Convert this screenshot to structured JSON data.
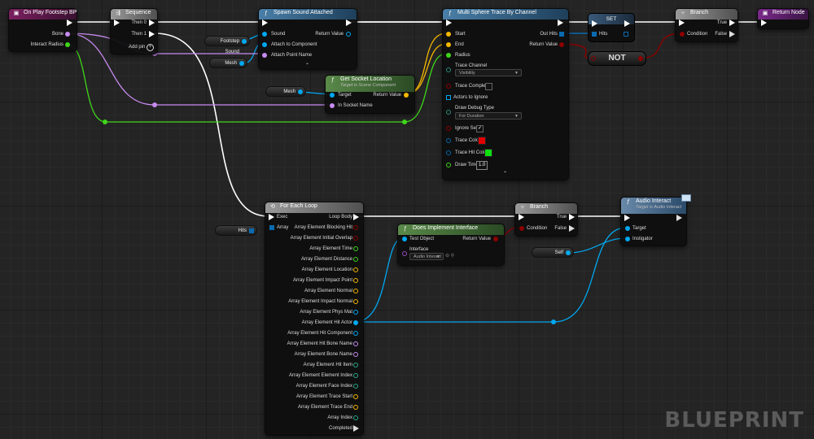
{
  "watermark": "BLUEPRINT",
  "event_node": {
    "title": "On Play Footstep BP",
    "pins": [
      "Bone",
      "Interact Radius"
    ]
  },
  "sequence_node": {
    "title": "Sequence",
    "then0": "Then 0",
    "then1": "Then 1",
    "add_pin": "Add pin"
  },
  "spawn_sound": {
    "title": "Spawn Sound Attached",
    "sound": "Sound",
    "attach_to": "Attach to Component",
    "attach_point": "Attach Point Name",
    "return_value": "Return Value"
  },
  "footstep_var": "Footstep Sound",
  "mesh_var1": "Mesh",
  "mesh_var2": "Mesh",
  "hits_var": "Hits",
  "self_var": "Self",
  "get_socket": {
    "title": "Get Socket Location",
    "subtitle": "Target is Scene Component",
    "target": "Target",
    "socket": "In Socket Name",
    "return_value": "Return Value"
  },
  "multi_trace": {
    "title": "Multi Sphere Trace By Channel",
    "start": "Start",
    "end": "End",
    "radius": "Radius",
    "out_hits": "Out Hits",
    "return_value": "Return Value",
    "trace_channel_label": "Trace Channel",
    "trace_channel_value": "Visibility",
    "trace_complex": "Trace Complex",
    "actors_ignore": "Actors to Ignore",
    "draw_debug_label": "Draw Debug Type",
    "draw_debug_value": "For Duration",
    "ignore_self": "Ignore Self",
    "trace_color": "Trace Color",
    "trace_hit_color": "Trace Hit Color",
    "draw_time": "Draw Time",
    "draw_time_value": "1.0",
    "trace_color_hex": "#e00000",
    "trace_hit_color_hex": "#10e010"
  },
  "set_node": {
    "title": "SET",
    "hits": "Hits"
  },
  "not_node": "NOT",
  "branch1": {
    "title": "Branch",
    "condition": "Condition",
    "true": "True",
    "false": "False"
  },
  "return_node": {
    "title": "Return Node"
  },
  "foreach": {
    "title": "For Each Loop",
    "exec": "Exec",
    "array": "Array",
    "loop_body": "Loop Body",
    "outputs": [
      "Array Element Blocking Hit",
      "Array Element Initial Overlap",
      "Array Element Time",
      "Array Element Distance",
      "Array Element Location",
      "Array Element Impact Point",
      "Array Element Normal",
      "Array Element Impact Normal",
      "Array Element Phys Mat",
      "Array Element Hit Actor",
      "Array Element Hit Component",
      "Array Element Hit Bone Name",
      "Array Element Bone Name",
      "Array Element Hit Item",
      "Array Element Element Index",
      "Array Element Face Index",
      "Array Element Trace Start",
      "Array Element Trace End",
      "Array Index",
      "Completed"
    ]
  },
  "implements": {
    "title": "Does Implement Interface",
    "test_object": "Test Object",
    "return_value": "Return Value",
    "interface_label": "Interface",
    "interface_value": "Audio Interact"
  },
  "branch2": {
    "title": "Branch",
    "condition": "Condition",
    "true": "True",
    "false": "False"
  },
  "audio_interact": {
    "title": "Audio Interact",
    "subtitle": "Target is Audio Interact",
    "target": "Target",
    "instigator": "Instigator"
  },
  "colors": {
    "bool": "#8c0000",
    "vector": "#f5b800",
    "object": "#00a8f0",
    "float": "#3fd61a",
    "name": "#c78bf0",
    "struct": "#0067a8"
  }
}
